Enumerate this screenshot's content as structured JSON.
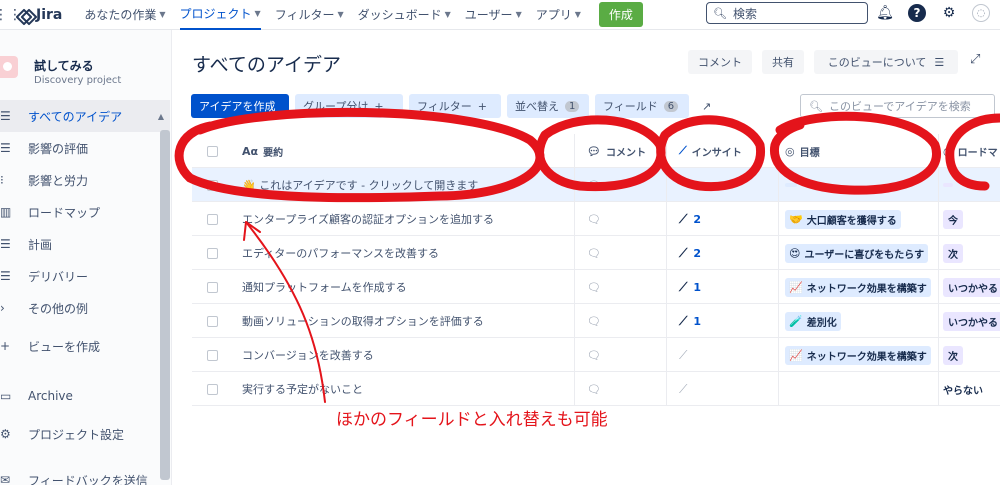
{
  "topnav": {
    "product": "Jira",
    "items": [
      {
        "label": "あなたの作業",
        "active": false
      },
      {
        "label": "プロジェクト",
        "active": true
      },
      {
        "label": "フィルター",
        "active": false
      },
      {
        "label": "ダッシュボード",
        "active": false
      },
      {
        "label": "ユーザー",
        "active": false
      },
      {
        "label": "アプリ",
        "active": false
      }
    ],
    "create_label": "作成",
    "search_placeholder": "検索",
    "icons": [
      "notification-icon",
      "help-icon",
      "settings-icon",
      "avatar"
    ]
  },
  "sidebar": {
    "project_name": "試してみる",
    "project_type": "Discovery project",
    "items": [
      {
        "label": "すべてのアイデア",
        "icon": "list-icon",
        "selected": true
      },
      {
        "label": "影響の評価",
        "icon": "list-icon"
      },
      {
        "label": "影響と労力",
        "icon": "matrix-icon"
      },
      {
        "label": "ロードマップ",
        "icon": "board-icon"
      },
      {
        "label": "計画",
        "icon": "list-icon"
      },
      {
        "label": "デリバリー",
        "icon": "list-icon"
      },
      {
        "label": "その他の例",
        "icon": "chevron-right-icon"
      },
      {
        "label": "ビューを作成",
        "icon": "plus-icon"
      },
      {
        "label": "Archive",
        "icon": "archive-icon"
      },
      {
        "label": "プロジェクト設定",
        "icon": "gear-icon"
      },
      {
        "label": "フィードバックを送信",
        "icon": "feedback-icon"
      }
    ]
  },
  "main": {
    "title": "すべてのアイデア",
    "header_buttons": {
      "comment": "コメント",
      "share": "共有",
      "about": "このビューについて"
    },
    "toolbar": {
      "create": "アイデアを作成",
      "group": "グループ分け",
      "filter": "フィルター",
      "sort": "並べ替え",
      "sort_count": "1",
      "fields": "フィールド",
      "fields_count": "6",
      "search_placeholder": "このビューでアイデアを検索"
    },
    "columns": {
      "summary": "要約",
      "comments": "コメント",
      "insights": "インサイト",
      "goal": "目標",
      "roadmap": "ロードマ"
    },
    "rows": [
      {
        "summary": "これはアイデアです - クリックして開きます",
        "insights": "",
        "goal": "",
        "goal_emoji": "",
        "roadmap": ""
      },
      {
        "summary": "エンタープライズ顧客の認証オプションを追加する",
        "insights": "2",
        "goal": "大口顧客を獲得する",
        "goal_emoji": "🤝",
        "roadmap": "今"
      },
      {
        "summary": "エディターのパフォーマンスを改善する",
        "insights": "2",
        "goal": "ユーザーに喜びをもたらす",
        "goal_emoji": "😍",
        "roadmap": "次"
      },
      {
        "summary": "通知プラットフォームを作成する",
        "insights": "1",
        "goal": "ネットワーク効果を構築す",
        "goal_emoji": "📈",
        "roadmap": "いつかやる"
      },
      {
        "summary": "動画ソリューションの取得オプションを評価する",
        "insights": "1",
        "goal": "差別化",
        "goal_emoji": "🧪",
        "roadmap": "いつかやる"
      },
      {
        "summary": "コンバージョンを改善する",
        "insights": "",
        "goal": "ネットワーク効果を構築す",
        "goal_emoji": "📈",
        "roadmap": "次"
      },
      {
        "summary": "実行する予定がないこと",
        "insights": "",
        "goal": "",
        "goal_emoji": "",
        "roadmap": "やらない"
      }
    ]
  },
  "annotation": {
    "text": "ほかのフィールドと入れ替えも可能",
    "color": "#e4141b"
  }
}
